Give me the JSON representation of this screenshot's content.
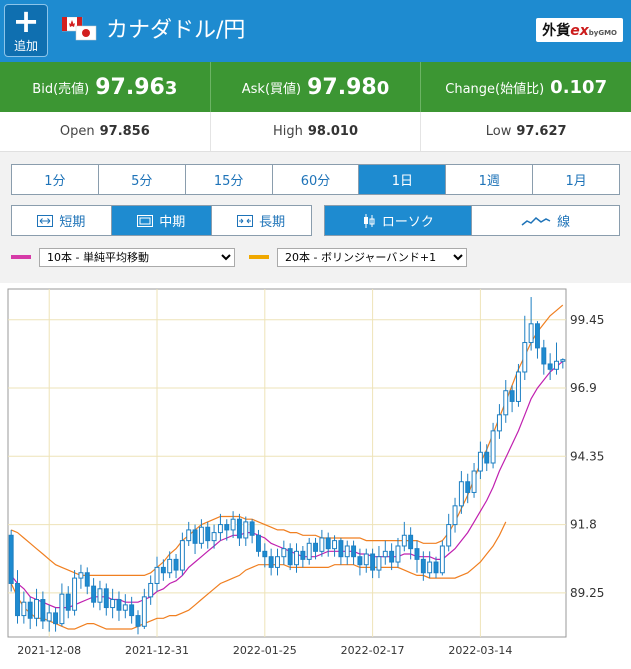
{
  "header": {
    "add_icon": "plus-icon",
    "add_label": "追加",
    "flag_icon": "canada-japan-flag-icon",
    "title": "カナダドル/円",
    "brand": {
      "prefix": "外貨",
      "ex": "ex",
      "suffix": "byGMO"
    }
  },
  "quotes": {
    "bid": {
      "label": "Bid(売値)",
      "value_main": "97.96",
      "value_tail": "3"
    },
    "ask": {
      "label": "Ask(買値)",
      "value_main": "97.98",
      "value_tail": "0"
    },
    "change": {
      "label": "Change(始値比)",
      "value": "0.107"
    }
  },
  "ohl": {
    "open": {
      "label": "Open",
      "value": "97.856"
    },
    "high": {
      "label": "High",
      "value": "98.010"
    },
    "low": {
      "label": "Low",
      "value": "97.627"
    }
  },
  "periods": [
    "1分",
    "5分",
    "15分",
    "60分",
    "1日",
    "1週",
    "1月"
  ],
  "active_period": "1日",
  "term": {
    "items": [
      {
        "label": "短期",
        "icon": "expand-arrows-icon"
      },
      {
        "label": "中期",
        "icon": "window-icon"
      },
      {
        "label": "長期",
        "icon": "contract-arrows-icon"
      }
    ],
    "active": "中期"
  },
  "kind": {
    "items": [
      {
        "label": "ローソク",
        "icon": "candlestick-icon"
      },
      {
        "label": "線",
        "icon": "line-chart-icon"
      }
    ],
    "active": "ローソク"
  },
  "indicators": {
    "sma": {
      "selected": "10本 - 単純平均移動",
      "color": "#d63ba8"
    },
    "bb": {
      "selected": "20本 - ボリンジャーバンド+1",
      "color": "#f0a800"
    }
  },
  "colors": {
    "up": "#1e8bd0",
    "down": "#1e8bd0",
    "sma": "#c020b0",
    "bb": "#f07f20"
  },
  "chart_data": {
    "type": "candlestick",
    "y_ticks": [
      "99.45",
      "96.9",
      "94.35",
      "91.8",
      "89.25"
    ],
    "y_tick_values": [
      99.45,
      96.9,
      94.35,
      91.8,
      89.25
    ],
    "ylim": [
      87.6,
      100.6
    ],
    "x_ticks": [
      "2021-12-08",
      "2021-12-31",
      "2022-01-25",
      "2022-02-17",
      "2022-03-14"
    ],
    "x_tick_index": [
      6,
      23,
      40,
      57,
      74
    ],
    "candles": [
      [
        91.4,
        89.6,
        91.6,
        89.3
      ],
      [
        89.6,
        88.4,
        90.1,
        88.1
      ],
      [
        88.4,
        88.9,
        89.3,
        88.1
      ],
      [
        88.9,
        88.3,
        89.1,
        87.9
      ],
      [
        88.3,
        89.0,
        89.4,
        88.0
      ],
      [
        89.0,
        88.2,
        89.3,
        87.9
      ],
      [
        88.2,
        88.5,
        88.8,
        87.8
      ],
      [
        88.5,
        88.1,
        88.7,
        87.8
      ],
      [
        88.1,
        89.2,
        89.6,
        88.0
      ],
      [
        89.2,
        88.6,
        89.5,
        88.3
      ],
      [
        88.6,
        89.8,
        90.1,
        88.4
      ],
      [
        89.8,
        90.0,
        90.3,
        89.4
      ],
      [
        90.0,
        89.5,
        90.2,
        89.2
      ],
      [
        89.5,
        88.9,
        89.8,
        88.7
      ],
      [
        88.9,
        89.4,
        89.7,
        88.6
      ],
      [
        89.4,
        88.7,
        89.6,
        88.4
      ],
      [
        88.7,
        89.0,
        89.4,
        88.3
      ],
      [
        89.0,
        88.6,
        89.3,
        88.2
      ],
      [
        88.6,
        88.8,
        89.2,
        88.3
      ],
      [
        88.8,
        88.4,
        89.1,
        88.1
      ],
      [
        88.4,
        88.0,
        88.6,
        87.7
      ],
      [
        88.0,
        89.1,
        89.4,
        87.9
      ],
      [
        89.1,
        89.6,
        89.9,
        88.8
      ],
      [
        89.6,
        90.2,
        90.6,
        89.3
      ],
      [
        90.2,
        90.0,
        90.5,
        89.7
      ],
      [
        90.0,
        90.5,
        90.8,
        89.8
      ],
      [
        90.5,
        90.1,
        90.7,
        89.8
      ],
      [
        90.1,
        91.2,
        91.5,
        89.9
      ],
      [
        91.2,
        91.6,
        91.9,
        91.0
      ],
      [
        91.6,
        91.1,
        91.8,
        90.7
      ],
      [
        91.1,
        91.7,
        92.0,
        90.9
      ],
      [
        91.7,
        91.2,
        91.9,
        90.9
      ],
      [
        91.2,
        91.5,
        91.8,
        90.9
      ],
      [
        91.5,
        91.8,
        92.2,
        91.2
      ],
      [
        91.8,
        91.6,
        92.0,
        91.2
      ],
      [
        91.6,
        92.0,
        92.3,
        91.3
      ],
      [
        92.0,
        91.3,
        92.2,
        91.0
      ],
      [
        91.3,
        91.9,
        92.1,
        91.0
      ],
      [
        91.9,
        91.4,
        92.0,
        91.1
      ],
      [
        91.4,
        90.8,
        91.6,
        90.6
      ],
      [
        90.8,
        90.6,
        91.1,
        90.2
      ],
      [
        90.6,
        90.2,
        90.9,
        89.9
      ],
      [
        90.2,
        90.6,
        90.9,
        89.9
      ],
      [
        90.6,
        90.9,
        91.2,
        90.3
      ],
      [
        90.9,
        90.3,
        91.1,
        90.1
      ],
      [
        90.3,
        90.8,
        91.1,
        90.0
      ],
      [
        90.8,
        90.5,
        91.0,
        90.2
      ],
      [
        90.5,
        91.1,
        91.3,
        90.3
      ],
      [
        91.1,
        90.8,
        91.3,
        90.5
      ],
      [
        90.8,
        91.3,
        91.6,
        90.6
      ],
      [
        91.3,
        90.9,
        91.5,
        90.6
      ],
      [
        90.9,
        91.2,
        91.4,
        90.6
      ],
      [
        91.2,
        90.6,
        91.3,
        90.3
      ],
      [
        90.6,
        91.0,
        91.2,
        90.3
      ],
      [
        91.0,
        90.6,
        91.2,
        90.3
      ],
      [
        90.6,
        90.3,
        90.9,
        89.9
      ],
      [
        90.3,
        90.7,
        90.9,
        90.0
      ],
      [
        90.7,
        90.1,
        90.9,
        89.8
      ],
      [
        90.1,
        90.6,
        91.0,
        89.8
      ],
      [
        90.6,
        90.8,
        91.2,
        90.3
      ],
      [
        90.8,
        90.4,
        91.1,
        90.1
      ],
      [
        90.4,
        91.0,
        91.3,
        90.2
      ],
      [
        91.0,
        91.4,
        91.9,
        90.8
      ],
      [
        91.4,
        90.9,
        91.7,
        90.5
      ],
      [
        90.9,
        90.5,
        91.2,
        90.0
      ],
      [
        90.5,
        90.0,
        90.8,
        89.7
      ],
      [
        90.0,
        90.4,
        90.8,
        89.8
      ],
      [
        90.4,
        90.0,
        90.6,
        89.8
      ],
      [
        90.0,
        91.0,
        91.2,
        89.9
      ],
      [
        91.0,
        91.8,
        92.2,
        90.8
      ],
      [
        91.8,
        92.5,
        92.8,
        91.5
      ],
      [
        92.5,
        93.4,
        93.8,
        92.2
      ],
      [
        93.4,
        93.0,
        93.7,
        92.6
      ],
      [
        93.0,
        93.8,
        94.1,
        92.8
      ],
      [
        93.8,
        94.5,
        94.9,
        93.5
      ],
      [
        94.5,
        94.1,
        94.8,
        93.8
      ],
      [
        94.1,
        95.3,
        95.6,
        93.9
      ],
      [
        95.3,
        95.9,
        96.3,
        95.0
      ],
      [
        95.9,
        96.8,
        97.2,
        95.6
      ],
      [
        96.8,
        96.4,
        97.0,
        96.0
      ],
      [
        96.4,
        97.5,
        97.8,
        96.2
      ],
      [
        97.5,
        98.6,
        99.6,
        97.2
      ],
      [
        98.6,
        99.3,
        100.3,
        98.3
      ],
      [
        99.3,
        98.4,
        99.4,
        98.0
      ],
      [
        98.4,
        97.8,
        98.7,
        97.4
      ],
      [
        97.8,
        97.6,
        98.2,
        97.2
      ],
      [
        97.6,
        97.9,
        98.6,
        97.4
      ],
      [
        97.9,
        97.96,
        98.01,
        97.63
      ]
    ],
    "sma10": [
      89.9,
      89.6,
      89.4,
      89.1,
      89.0,
      88.9,
      88.8,
      88.7,
      88.7,
      88.7,
      88.8,
      88.9,
      89.0,
      89.1,
      89.1,
      89.1,
      89.0,
      89.0,
      88.9,
      88.9,
      88.9,
      89.0,
      89.1,
      89.3,
      89.4,
      89.6,
      89.7,
      89.9,
      90.2,
      90.4,
      90.6,
      90.8,
      91.0,
      91.2,
      91.3,
      91.4,
      91.4,
      91.5,
      91.5,
      91.4,
      91.3,
      91.1,
      91.0,
      90.9,
      90.8,
      90.7,
      90.6,
      90.6,
      90.6,
      90.7,
      90.8,
      90.8,
      90.8,
      90.8,
      90.8,
      90.7,
      90.7,
      90.6,
      90.6,
      90.6,
      90.6,
      90.6,
      90.7,
      90.7,
      90.6,
      90.6,
      90.6,
      90.5,
      90.5,
      90.7,
      90.9,
      91.2,
      91.5,
      91.9,
      92.3,
      92.7,
      93.2,
      93.8,
      94.3,
      94.8,
      95.3,
      95.9,
      96.5,
      96.9,
      97.2,
      97.5,
      97.7,
      97.9
    ],
    "bb_upper": [
      91.6,
      91.5,
      91.3,
      91.1,
      90.9,
      90.7,
      90.5,
      90.3,
      90.2,
      90.1,
      90.0,
      89.9,
      89.9,
      89.9,
      89.9,
      89.9,
      89.9,
      89.9,
      89.9,
      89.9,
      89.9,
      89.9,
      90.0,
      90.2,
      90.4,
      90.7,
      90.9,
      91.2,
      91.4,
      91.6,
      91.8,
      91.9,
      92.0,
      92.1,
      92.1,
      92.1,
      92.1,
      92.0,
      92.0,
      91.9,
      91.8,
      91.7,
      91.6,
      91.6,
      91.5,
      91.5,
      91.4,
      91.4,
      91.4,
      91.3,
      91.3,
      91.3,
      91.3,
      91.3,
      91.3,
      91.3,
      91.2,
      91.2,
      91.2,
      91.2,
      91.2,
      91.2,
      91.2,
      91.2,
      91.2,
      91.1,
      91.1,
      91.1,
      91.2,
      91.5,
      91.9,
      92.4,
      92.9,
      93.5,
      94.1,
      94.6,
      95.2,
      95.8,
      96.4,
      97.0,
      97.6,
      98.1,
      98.6,
      99.0,
      99.3,
      99.6,
      99.8,
      100.0
    ],
    "bb_mid": [
      90.6,
      90.3,
      90.0,
      89.8,
      89.6,
      89.5,
      89.3,
      89.2,
      89.1,
      89.0,
      89.0,
      89.0,
      89.0,
      89.0,
      88.9,
      88.9,
      88.9,
      88.9,
      88.9,
      88.9,
      89.0,
      89.0,
      89.1,
      89.2,
      89.3,
      89.5,
      89.6,
      89.8,
      90.0,
      90.2,
      90.4,
      90.5,
      90.7,
      90.8,
      90.9,
      91.0,
      91.0,
      91.1,
      91.1,
      91.1,
      91.0,
      91.0,
      90.9,
      90.9,
      90.9,
      90.9,
      90.8,
      90.8,
      90.8,
      90.8,
      90.8,
      90.8,
      90.8,
      90.8,
      90.8,
      90.8,
      90.7,
      90.7,
      90.7,
      90.7,
      90.7,
      90.7,
      90.7,
      90.7,
      90.7,
      90.6,
      90.6,
      90.6,
      90.7,
      90.8,
      91.0,
      91.3,
      91.6,
      91.9,
      92.3,
      92.7,
      93.2,
      93.7,
      94.2,
      94.7,
      95.2,
      95.7,
      96.2,
      96.6,
      96.9,
      97.1,
      97.3,
      97.5
    ],
    "bb_lower": [
      89.6,
      89.1,
      88.7,
      88.5,
      88.3,
      88.3,
      88.2,
      88.1,
      88.0,
      87.9,
      87.9,
      88.0,
      88.1,
      88.1,
      88.0,
      87.9,
      87.9,
      87.9,
      87.9,
      87.9,
      88.0,
      88.1,
      88.2,
      88.3,
      88.3,
      88.4,
      88.4,
      88.5,
      88.6,
      88.8,
      89.0,
      89.2,
      89.4,
      89.6,
      89.7,
      89.8,
      89.9,
      90.1,
      90.2,
      90.3,
      90.3,
      90.3,
      90.3,
      90.3,
      90.2,
      90.2,
      90.2,
      90.2,
      90.2,
      90.2,
      90.2,
      90.3,
      90.3,
      90.3,
      90.3,
      90.2,
      90.2,
      90.2,
      90.2,
      90.2,
      90.2,
      90.2,
      90.1,
      90.0,
      89.9,
      89.9,
      89.8,
      89.8,
      89.8,
      89.8,
      89.8,
      89.9,
      90.0,
      90.2,
      90.4,
      90.7,
      91.0,
      91.4,
      91.9
    ]
  }
}
